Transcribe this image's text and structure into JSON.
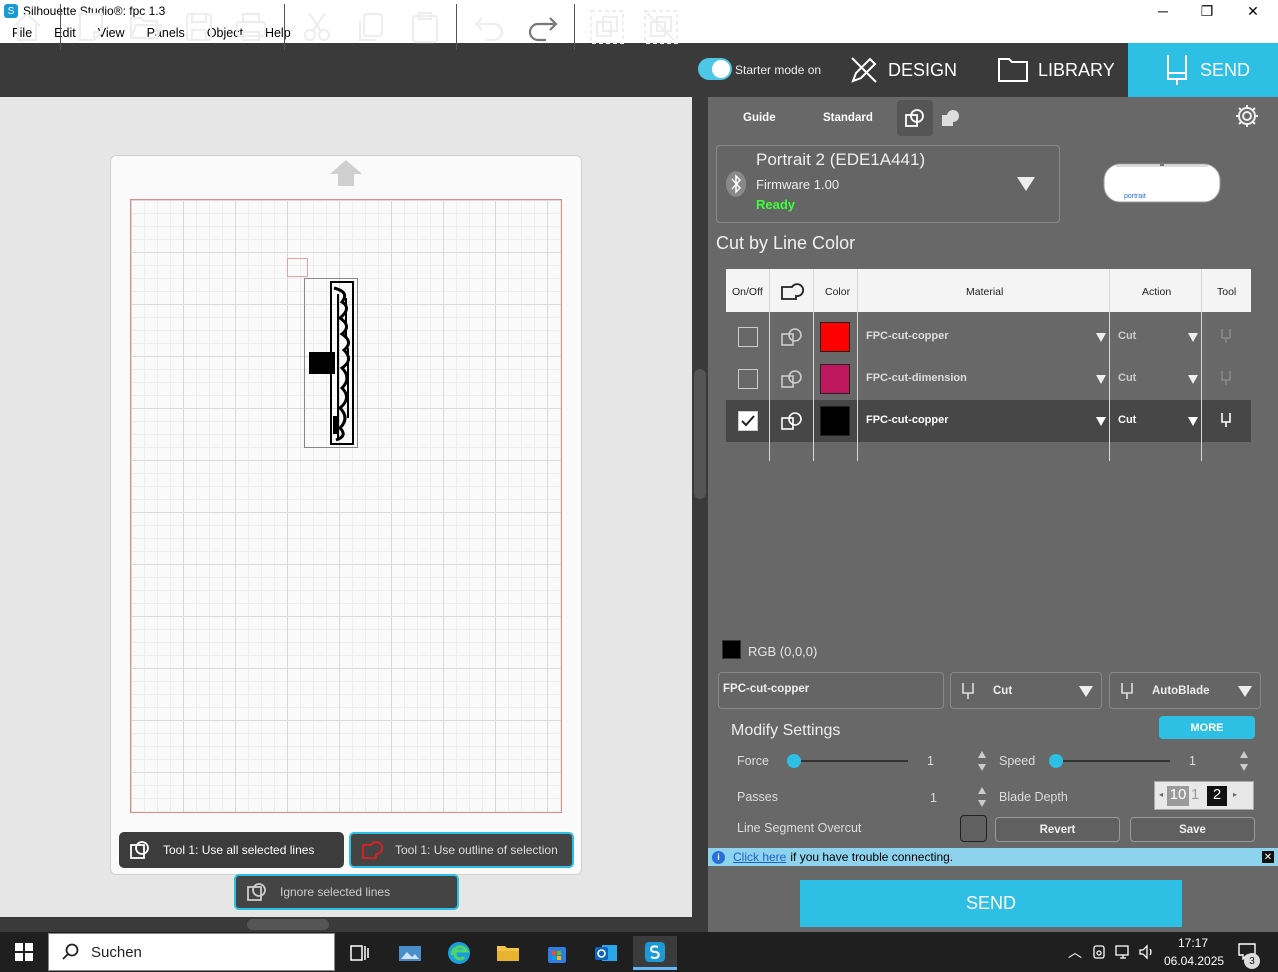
{
  "window": {
    "title": "Silhouette Studio®: fpc 1.3",
    "minimize": "─",
    "maximize": "❐",
    "close": "✕"
  },
  "menu": [
    "File",
    "Edit",
    "View",
    "Panels",
    "Object",
    "Help"
  ],
  "toolbar": {
    "starter_mode": "Starter mode on"
  },
  "nav": {
    "design": "DESIGN",
    "library": "LIBRARY",
    "send": "SEND"
  },
  "canvas_chips": {
    "use_all": "Tool 1: Use all selected lines",
    "use_outline": "Tool 1: Use outline of selection",
    "ignore": "Ignore selected lines"
  },
  "panel": {
    "tabs": [
      "Guide",
      "Standard"
    ],
    "device": {
      "name": "Portrait 2 (EDE1A441)",
      "firmware": "Firmware 1.00",
      "status": "Ready",
      "status_color": "#3cff3c",
      "logo": "portrait"
    },
    "section_title": "Cut by Line Color",
    "table": {
      "headers": {
        "onoff": "On/Off",
        "color": "Color",
        "material": "Material",
        "action": "Action",
        "tool": "Tool"
      },
      "rows": [
        {
          "checked": false,
          "color": "#ff0000",
          "material": "FPC-cut-copper",
          "action": "Cut"
        },
        {
          "checked": false,
          "color": "#c0185f",
          "material": "FPC-cut-dimension",
          "action": "Cut"
        },
        {
          "checked": true,
          "color": "#000000",
          "material": "FPC-cut-copper",
          "action": "Cut"
        }
      ]
    },
    "rgb_label": "RGB (0,0,0)",
    "material_field": "FPC-cut-copper",
    "action_field": "Cut",
    "tool_field": "AutoBlade",
    "modify_title": "Modify Settings",
    "more": "MORE",
    "force_label": "Force",
    "force_value": "1",
    "speed_label": "Speed",
    "speed_value": "1",
    "passes_label": "Passes",
    "passes_value": "1",
    "blade_label": "Blade Depth",
    "blade_value_a": "10",
    "blade_value_b": "1",
    "blade_value_c": "2",
    "overcut_label": "Line Segment Overcut",
    "revert": "Revert",
    "save": "Save",
    "info_link": "Click here",
    "info_text": "if you have trouble connecting.",
    "send": "SEND"
  },
  "taskbar": {
    "search": "Suchen",
    "time": "17:17",
    "date": "06.04.2025",
    "notifications": "3"
  }
}
